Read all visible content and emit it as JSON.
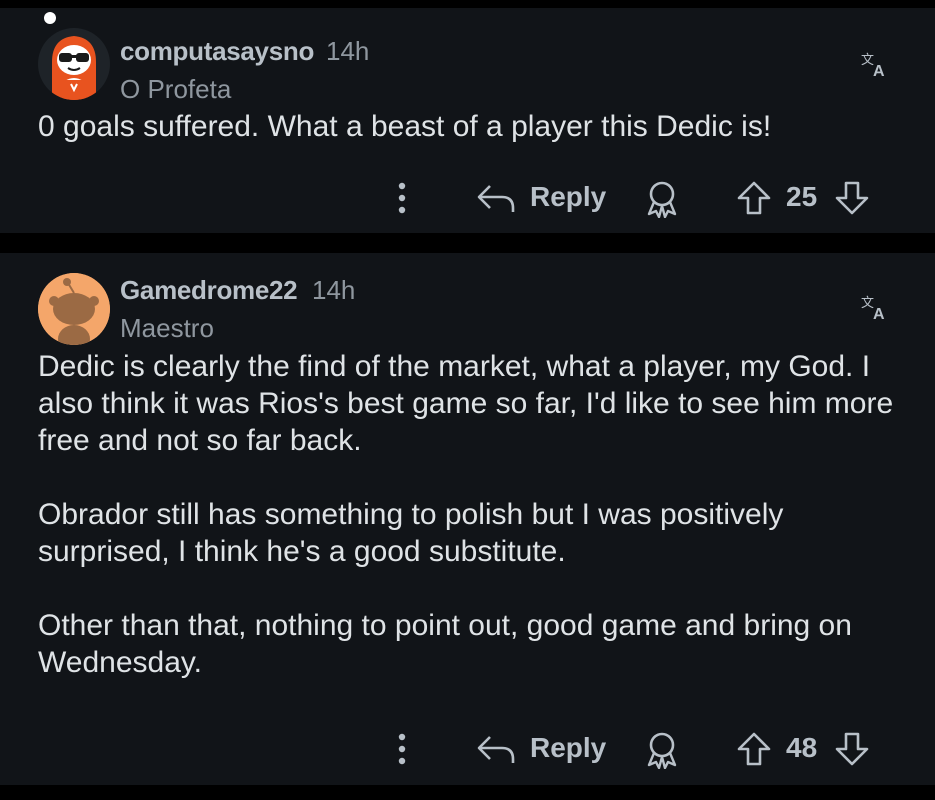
{
  "comments": [
    {
      "username": "computasaysno",
      "time": "14h",
      "flair": "O Profeta",
      "body": [
        "0 goals suffered. What a beast of a player this Dedic is!"
      ],
      "reply_label": "Reply",
      "score": "25",
      "avatar_icon": "snoo-hoodie-sunglasses-avatar",
      "online": true
    },
    {
      "username": "Gamedrome22",
      "time": "14h",
      "flair": "Maestro",
      "body": [
        "Dedic is clearly the find of the market, what a player, my God. I also think it was Rios's best game so far, I'd like to see him more free and not so far back.",
        "Obrador still has something to polish but I was positively surprised, I think he's a good substitute.",
        "Other than that, nothing to point out, good game and bring on Wednesday."
      ],
      "reply_label": "Reply",
      "score": "48",
      "avatar_icon": "default-snoo-avatar"
    }
  ],
  "colors": {
    "background": "#000000",
    "card": "#111418",
    "text": "#dfe3e6",
    "meta": "#8f979f",
    "icon": "#b8c0c8",
    "avatar_orange": "#f4a66a"
  }
}
